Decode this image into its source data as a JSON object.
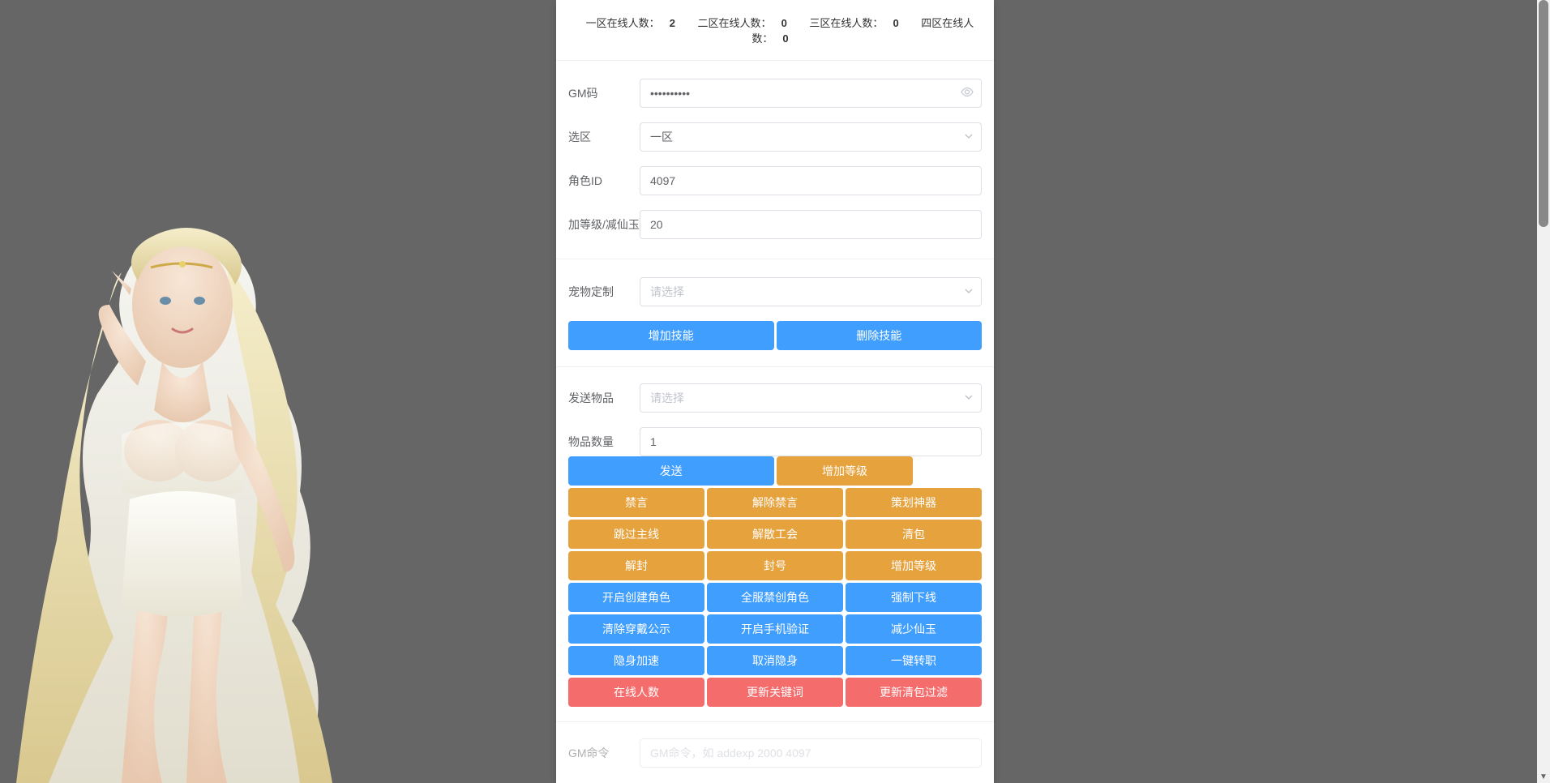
{
  "header": {
    "zones": [
      {
        "label": "一区在线人数：",
        "count": 2
      },
      {
        "label": "二区在线人数：",
        "count": 0
      },
      {
        "label": "三区在线人数：",
        "count": 0
      },
      {
        "label": "四区在线人数：",
        "count": 0
      }
    ]
  },
  "form": {
    "gm_code": {
      "label": "GM码",
      "value": "**********"
    },
    "zone": {
      "label": "选区",
      "value": "一区"
    },
    "role_id": {
      "label": "角色ID",
      "value": "4097"
    },
    "level_or_jade": {
      "label": "加等级/减仙玉",
      "value": "20"
    },
    "pet_custom": {
      "label": "宠物定制",
      "placeholder": "请选择"
    },
    "send_item": {
      "label": "发送物品",
      "placeholder": "请选择"
    },
    "item_count": {
      "label": "物品数量",
      "value": "1"
    },
    "gm_command": {
      "label": "GM命令",
      "placeholder": "GM命令，如 addexp 2000 4097"
    }
  },
  "buttons": {
    "add_skill": "增加技能",
    "del_skill": "删除技能",
    "send": "发送",
    "add_level_top": "增加等级",
    "row1": [
      "禁言",
      "解除禁言",
      "策划神器"
    ],
    "row2": [
      "跳过主线",
      "解散工会",
      "清包"
    ],
    "row3": [
      "解封",
      "封号",
      "增加等级"
    ],
    "row4": [
      "开启创建角色",
      "全服禁创角色",
      "强制下线"
    ],
    "row5": [
      "清除穿戴公示",
      "开启手机验证",
      "减少仙玉"
    ],
    "row6": [
      "隐身加速",
      "取消隐身",
      "一键转职"
    ],
    "row7": [
      "在线人数",
      "更新关键词",
      "更新清包过滤"
    ]
  }
}
